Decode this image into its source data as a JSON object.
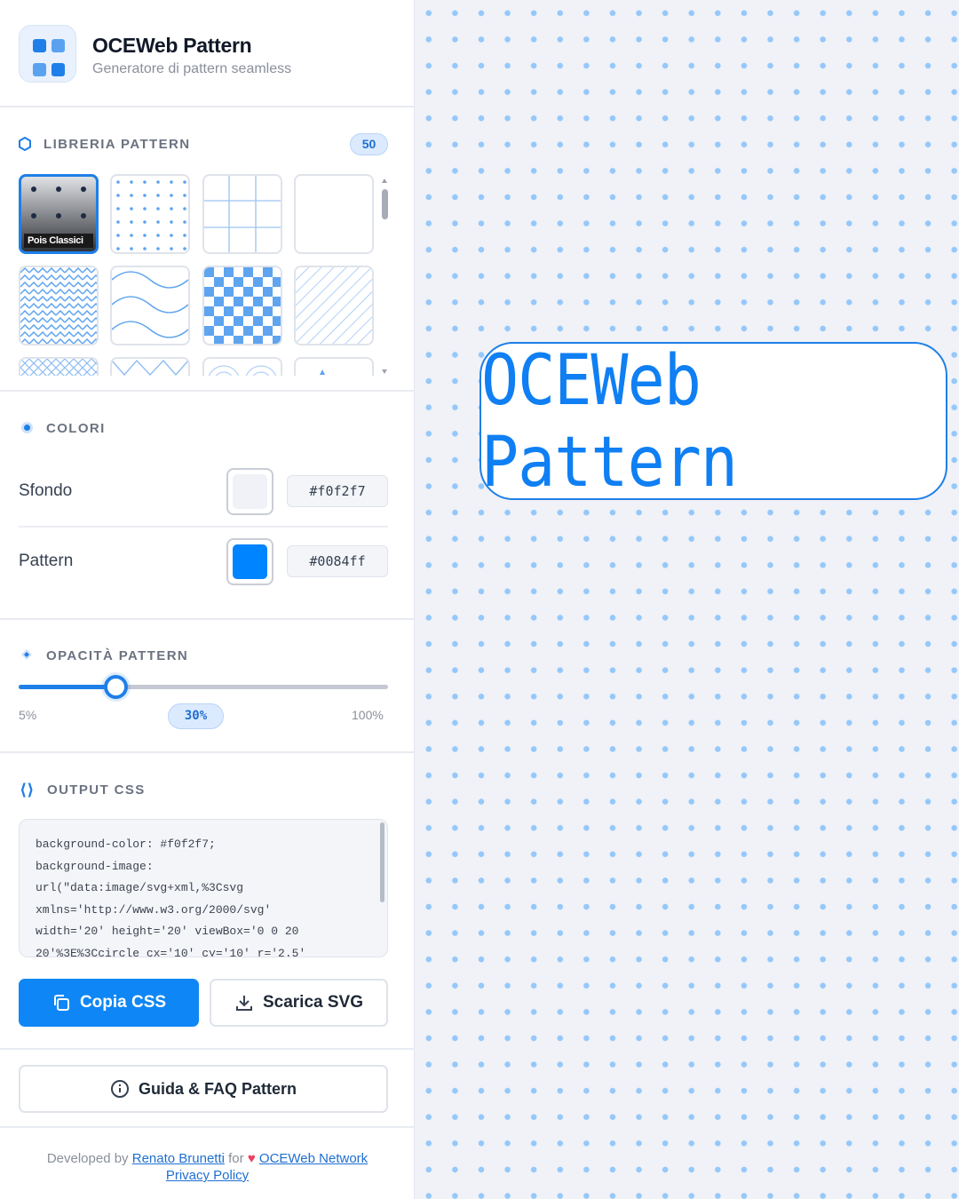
{
  "app": {
    "title": "OCEWeb Pattern",
    "subtitle": "Generatore di pattern seamless"
  },
  "library": {
    "title": "LIBRERIA PATTERN",
    "count": "50",
    "active_label": "Pois Classici",
    "tiles": [
      "pois-classici",
      "dots",
      "grid",
      "plain",
      "zigzag",
      "waves",
      "checkerboard",
      "diagonal",
      "cross",
      "triangles",
      "circles",
      "arrow"
    ]
  },
  "colors": {
    "title": "COLORI",
    "background_label": "Sfondo",
    "background_value": "#f0f2f7",
    "pattern_label": "Pattern",
    "pattern_value": "#0084ff",
    "accent": "#1f7fe8"
  },
  "opacity": {
    "title": "OPACITÀ PATTERN",
    "min": "5%",
    "max": "100%",
    "value_label": "30%",
    "value": 30
  },
  "output": {
    "title": "OUTPUT CSS",
    "code": "background-color: #f0f2f7;\nbackground-image:\nurl(\"data:image/svg+xml,%3Csvg\nxmlns='http://www.w3.org/2000/svg'\nwidth='20' height='20' viewBox='0 0 20\n20'%3E%3Ccircle cx='10' cy='10' r='2.5'",
    "copy_label": "Copia CSS",
    "download_label": "Scarica SVG"
  },
  "guide_label": "Guida & FAQ Pattern",
  "footer": {
    "developed_by": "Developed by",
    "author": "Renato Brunetti",
    "for": "for",
    "network": "OCEWeb Network",
    "privacy": "Privacy Policy"
  },
  "preview": {
    "text": "OCEWeb Pattern"
  }
}
